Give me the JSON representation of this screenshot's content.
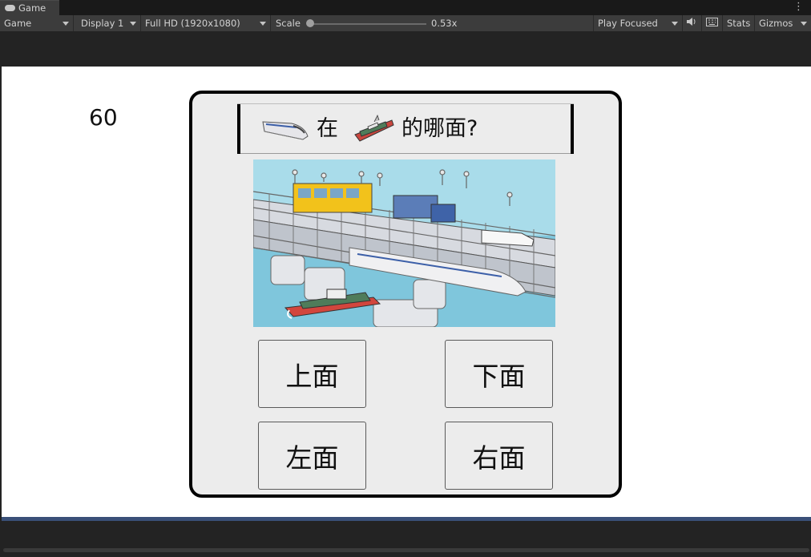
{
  "tabbar": {
    "tab_label": "Game"
  },
  "toolbar": {
    "view_select": "Game",
    "display_select": "Display 1",
    "resolution_select": "Full HD (1920x1080)",
    "scale_label": "Scale",
    "scale_value": "0.53x",
    "play_mode_select": "Play Focused",
    "stats_label": "Stats",
    "gizmos_label": "Gizmos"
  },
  "game": {
    "timer": "60",
    "question": {
      "word_in": "在",
      "word_where": "的哪面?"
    },
    "answers": [
      "上面",
      "下面",
      "左面",
      "右面"
    ]
  },
  "colors": {
    "editor_bg": "#232323",
    "toolbar_bg": "#3c3c3c",
    "panel_bg": "#ececec",
    "accent_bar": "#3a5078"
  }
}
